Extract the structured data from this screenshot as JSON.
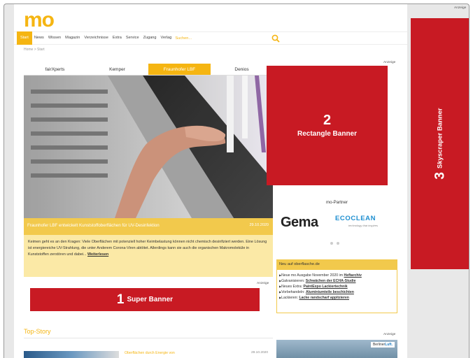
{
  "logo": "mo",
  "top_anzeige": "Anzeige",
  "nav": {
    "items": [
      "Start",
      "News",
      "Wissen",
      "Magazin",
      "Verzeichnisse",
      "Extra",
      "Service",
      "Zugang",
      "Verlag"
    ],
    "search_placeholder": "Suchen..."
  },
  "breadcrumb": "Home > Start",
  "tabs": [
    "fairXperts",
    "Kemper",
    "Fraunhofer LBF",
    "Denios"
  ],
  "hero": {
    "caption": "Fraunhofer LBF entwickelt Kunststoffoberflächen für UV-Desinfektion",
    "date": "29.10.2020",
    "teaser": "Keimen geht es an den Kragen: Viele Oberflächen mit potenziell hoher Keimbelastung können nicht chemisch desinfiziert werden. Eine Lösung ist energiereiche UV-Strahlung, die unter Anderem Corona-Viren abtötet. Allerdings kann sie auch die organischen Makromoleküle in Kunststoffen zerstören und dabei...",
    "more": "Weiterlesen"
  },
  "banners": {
    "super": {
      "num": "1",
      "label": "Super Banner",
      "anzeige": "Anzeige"
    },
    "rectangle": {
      "num": "2",
      "label": "Rectangle Banner",
      "anzeige": "Anzeige"
    },
    "skyscraper": {
      "num": "3",
      "label": "Skyscraper Banner"
    }
  },
  "partner": {
    "title": "mo-Partner",
    "gema": "Gema",
    "ecoclean": "ECOCLEAN",
    "ecoclean_sub": "technology that inspires"
  },
  "neu": {
    "heading": "Neu auf oberflasche.de",
    "items": [
      {
        "pre": "Neue mo Ausgabe November 2020 im ",
        "link": "Heftarchiv"
      },
      {
        "pre": "Galvanisieren: ",
        "link": "Schwächen der ECHA-Studie"
      },
      {
        "pre": "Neues Extra: ",
        "link": "PaintExpo Lackiertechnik"
      },
      {
        "pre": "Vorbehandeln: ",
        "link": "Aluminiumteile beschichten"
      },
      {
        "pre": "Lackieren: ",
        "link": "Lacke randscharf applizieren"
      }
    ]
  },
  "topstory": {
    "heading": "Top-Story",
    "title": "Oberflächen durch Energie von",
    "date": "29.10.2020",
    "anzeige": "Anzeige"
  },
  "ad2": {
    "tag_pre": "Berliner",
    "tag_bold": "Luft."
  },
  "colors": {
    "accent": "#f5b512",
    "banner": "#c81a23",
    "caption": "#f2c94c",
    "teaser_bg": "#fbe9a6"
  }
}
